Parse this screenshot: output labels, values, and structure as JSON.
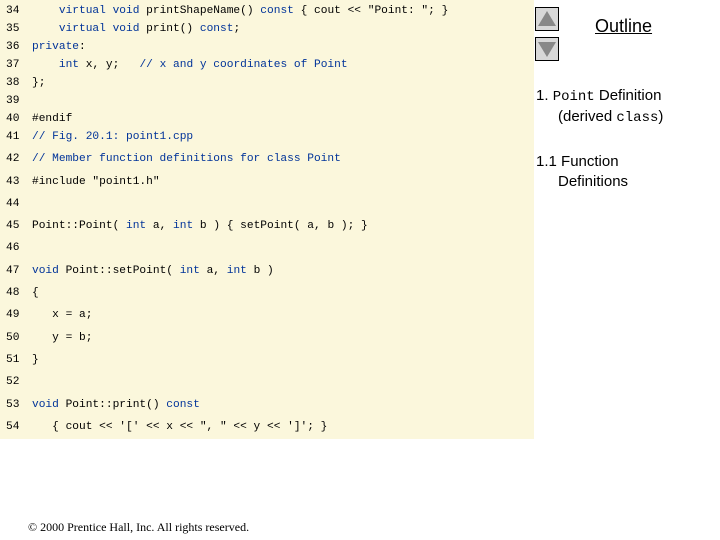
{
  "code": {
    "lines": [
      {
        "n": "34",
        "t": "    virtual void printShapeName() const { cout << \"Point: \"; }"
      },
      {
        "n": "35",
        "t": "    virtual void print() const;"
      },
      {
        "n": "36",
        "t": "private:"
      },
      {
        "n": "37",
        "t": "    int x, y;   // x and y coordinates of Point"
      },
      {
        "n": "38",
        "t": "};"
      },
      {
        "n": "39",
        "t": ""
      },
      {
        "n": "40",
        "t": "#endif"
      },
      {
        "n": "41",
        "t": "// Fig. 20.1: point1.cpp"
      },
      {
        "n": "42",
        "t": "// Member function definitions for class Point"
      },
      {
        "n": "43",
        "t": "#include \"point1.h\""
      },
      {
        "n": "44",
        "t": ""
      },
      {
        "n": "45",
        "t": "Point::Point( int a, int b ) { setPoint( a, b ); }"
      },
      {
        "n": "46",
        "t": ""
      },
      {
        "n": "47",
        "t": "void Point::setPoint( int a, int b )"
      },
      {
        "n": "48",
        "t": "{"
      },
      {
        "n": "49",
        "t": "   x = a;"
      },
      {
        "n": "50",
        "t": "   y = b;"
      },
      {
        "n": "51",
        "t": "}"
      },
      {
        "n": "52",
        "t": ""
      },
      {
        "n": "53",
        "t": "void Point::print() const"
      },
      {
        "n": "54",
        "t": "   { cout << '[' << x << \", \" << y << ']'; }"
      }
    ]
  },
  "nav": {
    "up_icon": "triangle-up-icon",
    "down_icon": "triangle-down-icon",
    "outline_label": "Outline"
  },
  "outline": {
    "item1_number": "1.",
    "item1_code": "Point",
    "item1_word": "Definition",
    "item1_paren_open": "(derived",
    "item1_code2": "class",
    "item1_paren_close": ")",
    "item2_number": "1.1",
    "item2_line1": "Function",
    "item2_line2": "Definitions"
  },
  "footer": {
    "copyright": "© 2000 Prentice Hall, Inc.  All rights reserved."
  },
  "colors": {
    "code_background": "#fbf7dc",
    "keyword": "#003399"
  }
}
